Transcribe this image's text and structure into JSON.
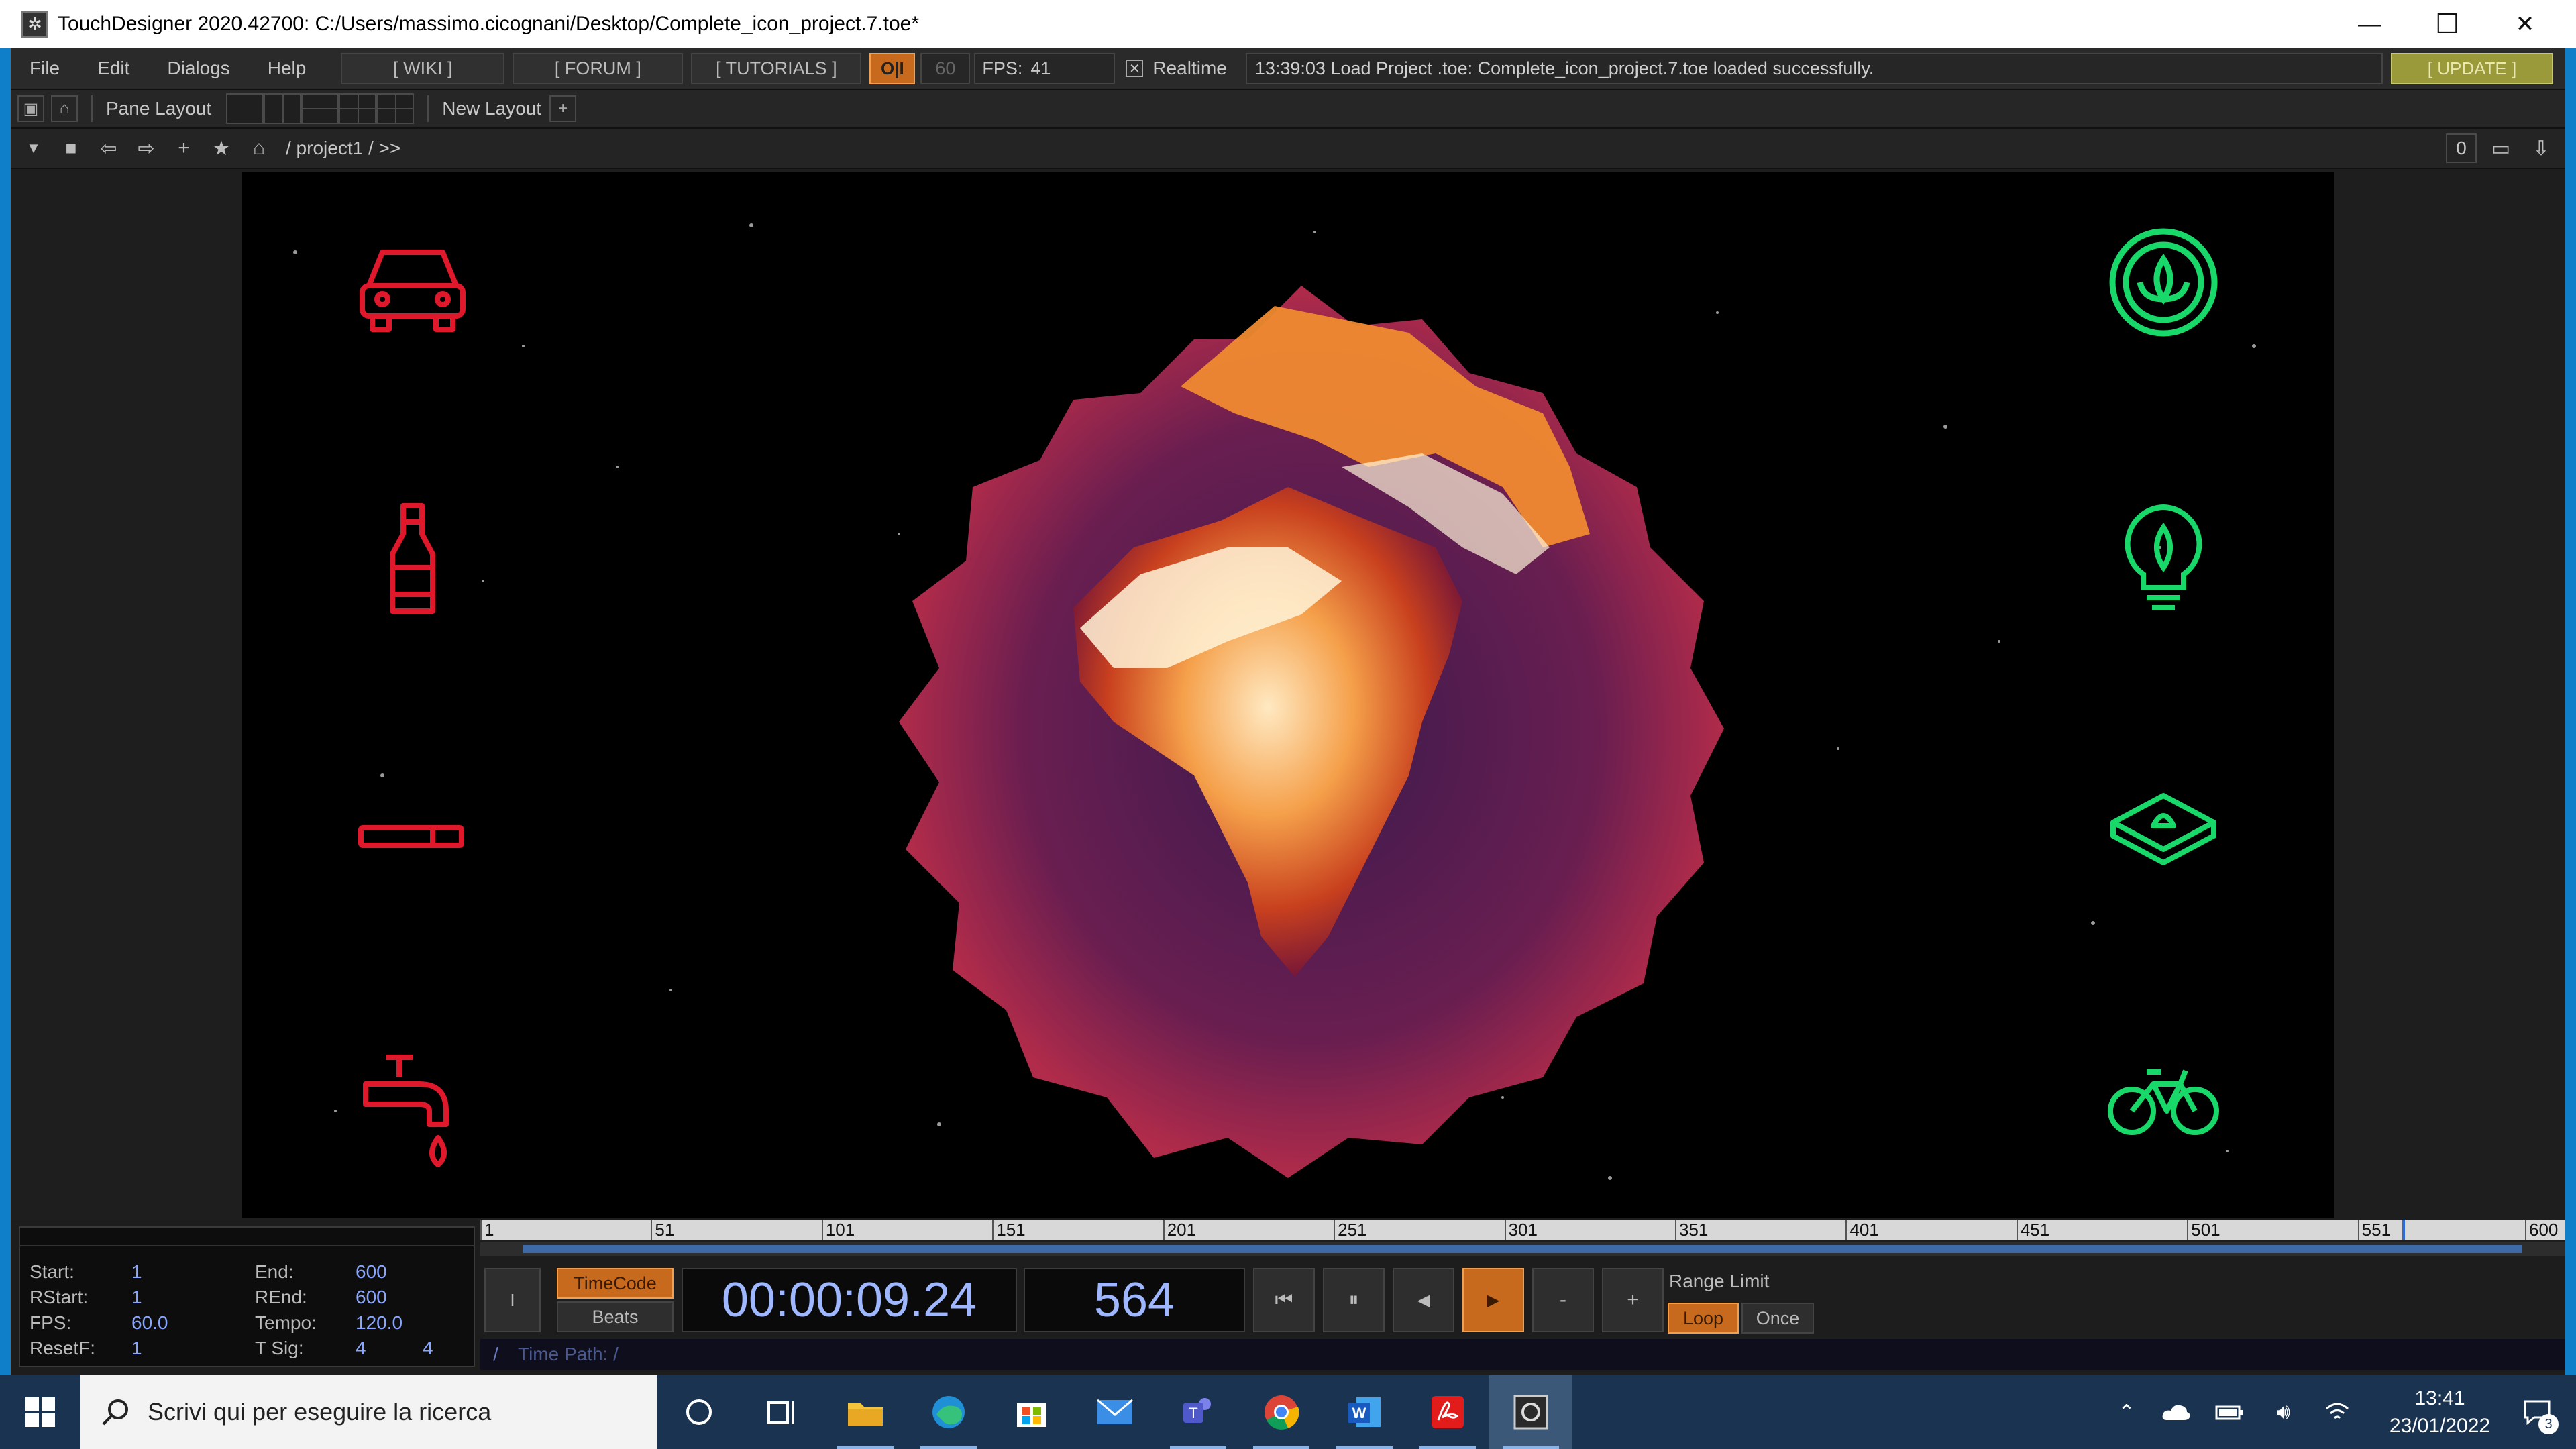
{
  "window": {
    "title": "TouchDesigner 2020.42700: C:/Users/massimo.cicognani/Desktop/Complete_icon_project.7.toe*",
    "minimize": "—",
    "maximize": "☐",
    "close": "✕"
  },
  "menu": {
    "items": [
      "File",
      "Edit",
      "Dialogs",
      "Help"
    ],
    "wiki": "[ WIKI ]",
    "forum": "[ FORUM ]",
    "tutorials": "[ TUTORIALS ]",
    "oi": "O|I",
    "fps_target": "60",
    "fps_label": "FPS:",
    "fps_value": "41",
    "realtime": "Realtime",
    "status_message": "13:39:03 Load Project .toe: Complete_icon_project.7.toe loaded successfully.",
    "update": "[ UPDATE ]"
  },
  "panebar": {
    "pane_layout": "Pane Layout",
    "new_layout": "New Layout",
    "add": "+"
  },
  "pathbar": {
    "path": "/ project1 / >>",
    "counter": "0"
  },
  "viewer": {
    "left_icons": [
      "car-icon",
      "bottle-icon",
      "cigarette-icon",
      "faucet-icon"
    ],
    "right_icons": [
      "leaf-circle-icon",
      "leaf-bulb-icon",
      "plant-box-icon",
      "bicycle-icon"
    ],
    "left_color": "#e0182c",
    "right_color": "#19d86a"
  },
  "timeline": {
    "stats": {
      "start_label": "Start:",
      "start": "1",
      "rstart_label": "RStart:",
      "rstart": "1",
      "fps_label": "FPS:",
      "fps": "60.0",
      "resetf_label": "ResetF:",
      "resetf": "1",
      "end_label": "End:",
      "end": "600",
      "rend_label": "REnd:",
      "rend": "600",
      "tempo_label": "Tempo:",
      "tempo": "120.0",
      "tsig_label": "T Sig:",
      "tsig_a": "4",
      "tsig_b": "4"
    },
    "ruler_ticks": [
      "1",
      "51",
      "101",
      "151",
      "201",
      "251",
      "301",
      "351",
      "401",
      "451",
      "501",
      "551",
      "600"
    ],
    "playhead_frame": 564,
    "timecode_btn": "TimeCode",
    "beats_btn": "Beats",
    "timecode": "00:00:09.24",
    "frame": "564",
    "range_limit": "Range Limit",
    "loop": "Loop",
    "once": "Once",
    "time_path_slash": "/",
    "time_path": "Time Path: /",
    "minus": "-",
    "plus": "+"
  },
  "taskbar": {
    "search_placeholder": "Scrivi qui per eseguire la ricerca",
    "time": "13:41",
    "date": "23/01/2022",
    "notifications": "3"
  }
}
